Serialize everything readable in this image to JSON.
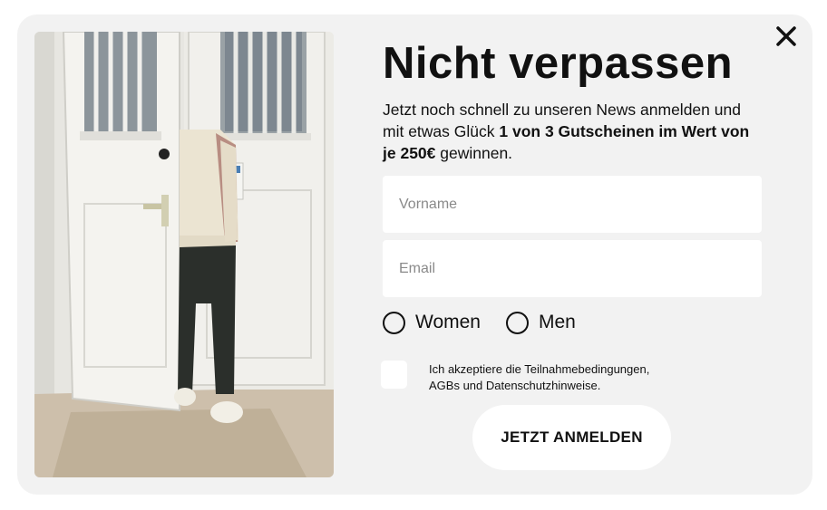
{
  "popup": {
    "title": "Nicht verpassen",
    "description_pre": "Jetzt noch schnell zu unseren News anmelden und mit etwas Glück ",
    "description_bold": "1 von 3 Gutscheinen im Wert von je 250€",
    "description_post": " gewinnen.",
    "close_icon": "close-icon",
    "image_alt": "person-standing-in-white-doorway"
  },
  "form": {
    "first_name_placeholder": "Vorname",
    "first_name_value": "",
    "email_placeholder": "Email",
    "email_value": "",
    "gender_options": [
      "Women",
      "Men"
    ],
    "gender_selected": null,
    "terms_checked": false,
    "terms_line1": "Ich akzeptiere die Teilnahmebedingungen,",
    "terms_line2": "AGBs und Datenschutzhinweise.",
    "submit_label": "JETZT ANMELDEN"
  },
  "colors": {
    "modal_background": "#f2f2f2",
    "text": "#111111",
    "input_background": "#ffffff",
    "placeholder": "#8a8a8a"
  }
}
